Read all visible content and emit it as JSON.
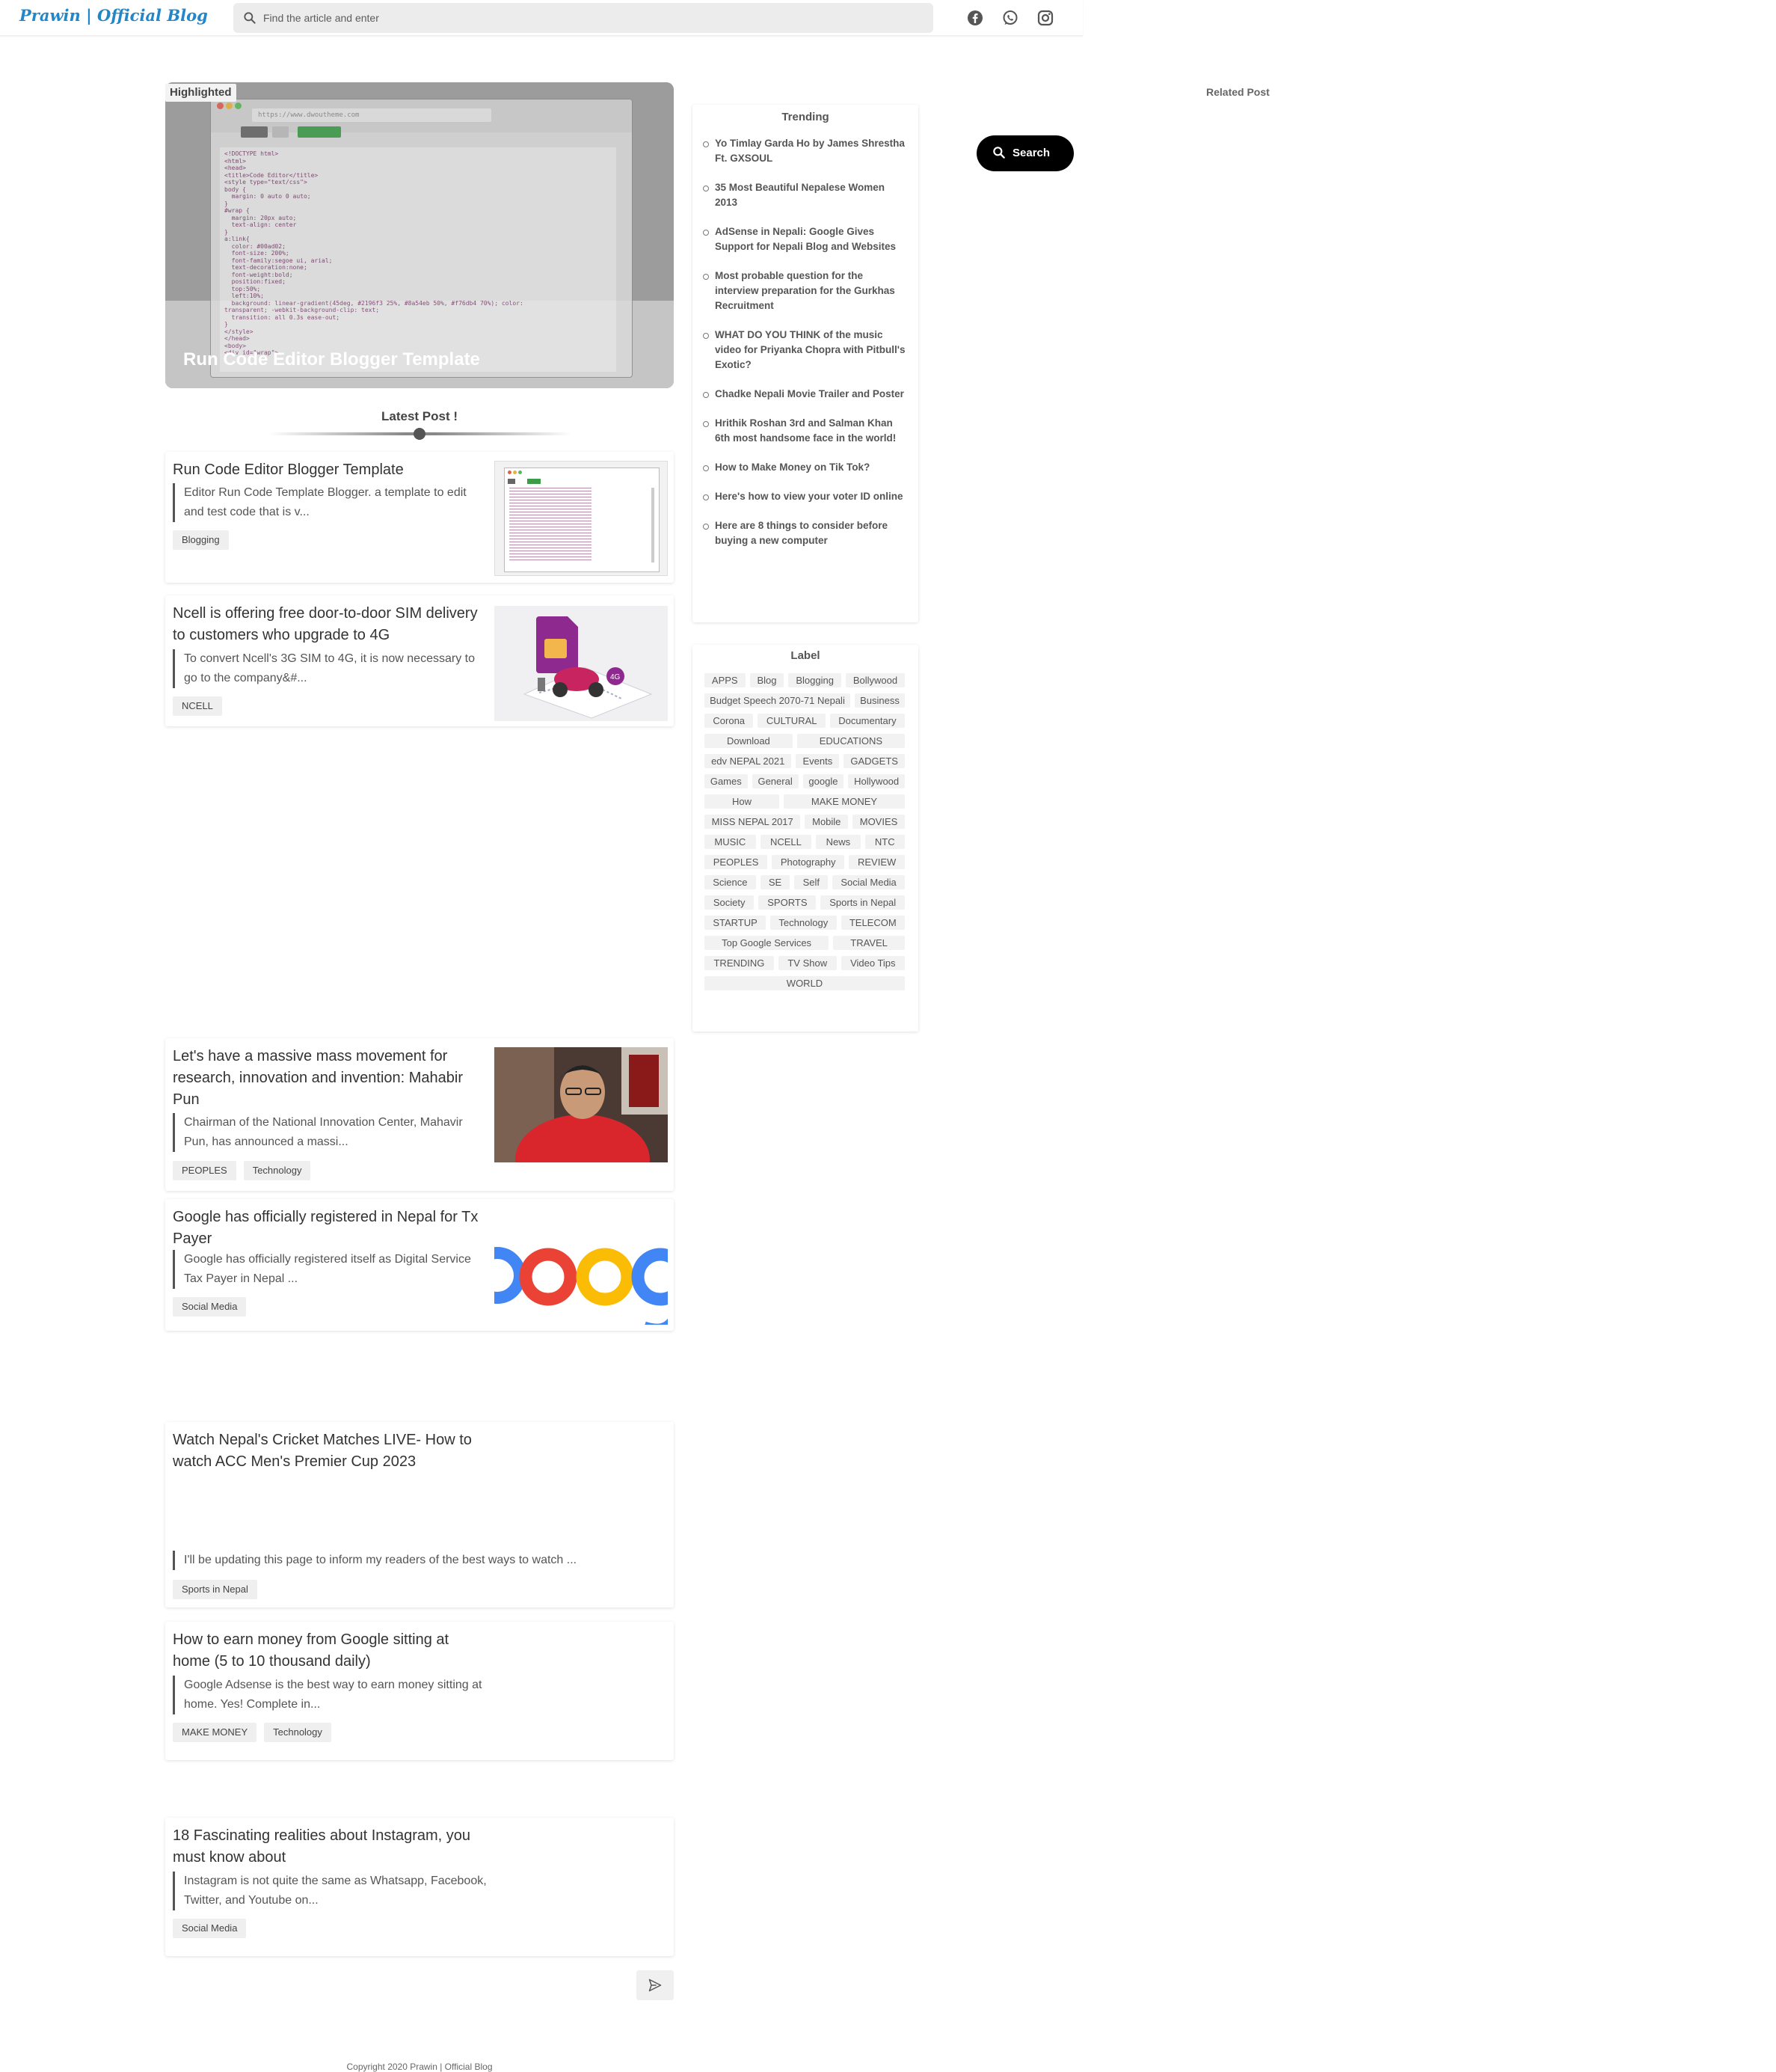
{
  "header": {
    "logo": "Prawin | Official Blog",
    "search_placeholder": "Find the article and enter",
    "social_icons": [
      "facebook-icon",
      "whatsapp-icon",
      "instagram-icon"
    ]
  },
  "highlight": {
    "label": "Highlighted",
    "title": "Run Code Editor Blogger Template",
    "browser_url": "https://www.dwoutheme.com"
  },
  "latest": {
    "heading": "Latest Post !"
  },
  "posts": [
    {
      "title": "Run Code Editor Blogger Template",
      "excerpt": "Editor Run Code Template Blogger.  a template to edit and test code that is v...",
      "tags": [
        "Blogging"
      ]
    },
    {
      "title": "Ncell is offering free door-to-door SIM delivery to customers who upgrade to 4G",
      "excerpt": "To convert Ncell's 3G SIM to 4G, it is now necessary to go to the company&#...",
      "tags": [
        "NCELL"
      ]
    },
    {
      "title": "Let's have a massive mass movement for research, innovation and invention: Mahabir Pun",
      "excerpt": "Chairman of the National Innovation Center, Mahavir Pun, has announced a massi...",
      "tags": [
        "PEOPLES",
        "Technology"
      ]
    },
    {
      "title": "Google has officially registered in Nepal for Tx Payer",
      "excerpt": "Google has officially registered itself as Digital Service Tax Payer in Nepal ...",
      "tags": [
        "Social Media"
      ]
    },
    {
      "title": "Watch Nepal's Cricket Matches LIVE- How to watch ACC Men's Premier Cup 2023",
      "excerpt": "I'll be updating this page to inform my readers of the best ways to watch ...",
      "tags": [
        "Sports in Nepal"
      ]
    },
    {
      "title": "How to earn money from Google sitting at home (5 to 10 thousand daily)",
      "excerpt": "Google Adsense is the best way to earn money sitting at home. Yes! Complete in...",
      "tags": [
        "MAKE MONEY",
        "Technology"
      ]
    },
    {
      "title": "18 Fascinating realities about Instagram, you must know about",
      "excerpt": "Instagram is not quite the same as Whatsapp, Facebook, Twitter, and Youtube on...",
      "tags": [
        "Social Media"
      ]
    }
  ],
  "trending": {
    "heading": "Trending",
    "items": [
      "Yo Timlay Garda Ho by James Shrestha Ft. GXSOUL",
      "35 Most Beautiful Nepalese Women 2013",
      "AdSense in Nepali: Google Gives Support for Nepali Blog and Websites",
      "Most probable question for the interview preparation for the Gurkhas Recruitment",
      "WHAT DO YOU THINK of the music video for Priyanka Chopra with Pitbull's Exotic?",
      "Chadke Nepali Movie Trailer and Poster",
      "Hrithik Roshan 3rd and Salman Khan 6th most handsome face in the world!",
      "How to Make Money on Tik Tok?",
      "Here's how to view your voter ID online",
      "Here are 8 things to consider before buying a new computer"
    ]
  },
  "labels": {
    "heading": "Label",
    "items": [
      "APPS",
      "Blog",
      "Blogging",
      "Bollywood",
      "Budget Speech 2070-71 Nepali",
      "Business",
      "Corona",
      "CULTURAL",
      "Documentary",
      "Download",
      "EDUCATIONS",
      "edv NEPAL 2021",
      "Events",
      "GADGETS",
      "Games",
      "General",
      "google",
      "Hollywood",
      "How",
      "MAKE MONEY",
      "MISS NEPAL 2017",
      "Mobile",
      "MOVIES",
      "MUSIC",
      "NCELL",
      "News",
      "NTC",
      "PEOPLES",
      "Photography",
      "REVIEW",
      "Science",
      "SE",
      "Self",
      "Social Media",
      "Society",
      "SPORTS",
      "Sports in Nepal",
      "STARTUP",
      "Technology",
      "TELECOM",
      "Top Google Services",
      "TRAVEL",
      "TRENDING",
      "TV Show",
      "Video Tips",
      "WORLD"
    ]
  },
  "related": {
    "heading": "Related Post"
  },
  "search_button": {
    "label": "Search"
  },
  "footer": {
    "copyright": "Copyright 2020 Prawin | Official Blog"
  },
  "colors": {
    "brand": "#2286c9",
    "google_red": "#ea4335",
    "google_yellow": "#fbbc05",
    "google_blue": "#4285f4",
    "ncell_purple": "#8e2a8f"
  }
}
